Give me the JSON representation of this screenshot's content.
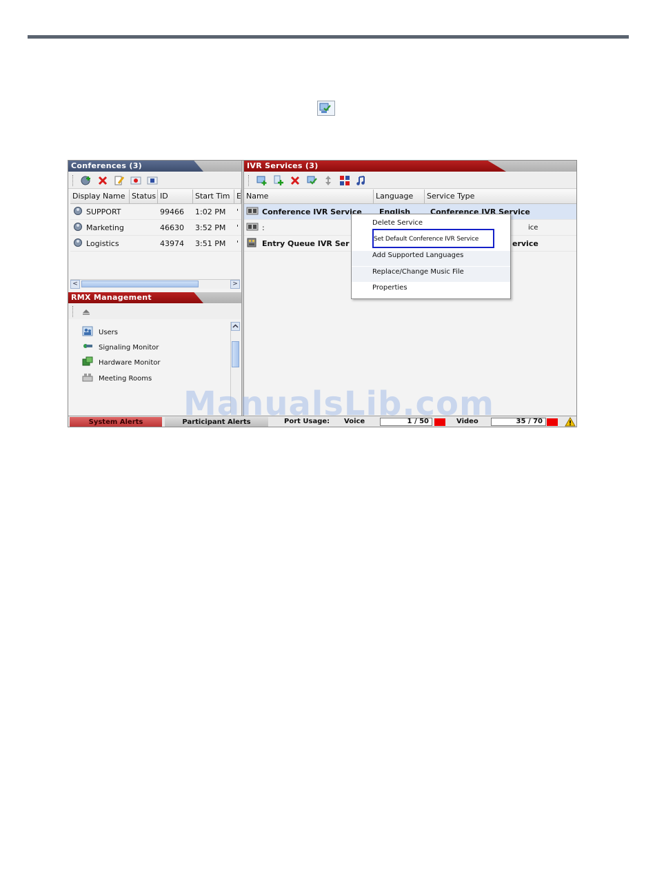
{
  "page": {
    "watermark": "ManualsLib.com",
    "inline_icon": "ivr-set-default-icon"
  },
  "conferences": {
    "title": "Conferences (3)",
    "toolbar_icons": [
      "new-conference-icon",
      "delete-icon",
      "edit-icon",
      "record-icon",
      "stop-icon"
    ],
    "columns": [
      "Display Name",
      "Status",
      "ID",
      "Start Tim",
      "E"
    ],
    "rows": [
      {
        "name": "SUPPORT",
        "status": "",
        "id": "99466",
        "start": "1:02 PM",
        "e": "'"
      },
      {
        "name": "Marketing",
        "status": "",
        "id": "46630",
        "start": "3:52 PM",
        "e": "'"
      },
      {
        "name": "Logistics",
        "status": "",
        "id": "43974",
        "start": "3:51 PM",
        "e": "'"
      }
    ],
    "scroll_left": "<",
    "scroll_right": ">"
  },
  "rmx_management": {
    "title": "RMX Management",
    "items": [
      {
        "label": "Users",
        "icon": "users-icon"
      },
      {
        "label": "Signaling Monitor",
        "icon": "signaling-monitor-icon"
      },
      {
        "label": "Hardware Monitor",
        "icon": "hardware-monitor-icon"
      },
      {
        "label": "Meeting Rooms",
        "icon": "meeting-rooms-icon"
      }
    ]
  },
  "ivr_services": {
    "title": "IVR Services (3)",
    "toolbar_icons": [
      "new-ivr-service-icon",
      "add-icon",
      "delete-icon",
      "set-default-icon",
      "move-icon",
      "language-icon",
      "music-icon"
    ],
    "columns": [
      "Name",
      "Language",
      "Service Type"
    ],
    "rows": [
      {
        "name": "Conference IVR Service",
        "language": "English",
        "type": "Conference IVR Service",
        "selected": true
      },
      {
        "name": ":",
        "language": "",
        "type": "ice",
        "selected": false
      },
      {
        "name": "Entry Queue IVR Ser",
        "language": "",
        "type": "ervice",
        "selected": false
      }
    ]
  },
  "context_menu": {
    "items": [
      "Delete Service",
      "Set Default Conference IVR Service",
      "Add Supported Languages",
      "Replace/Change Music File",
      "Properties"
    ],
    "highlighted_index": 1
  },
  "status_bar": {
    "system_alerts": "System Alerts",
    "participant_alerts": "Participant Alerts",
    "port_usage_label": "Port Usage:",
    "voice_label": "Voice",
    "voice_value": "1 / 50",
    "video_label": "Video",
    "video_value": "35 / 70",
    "colors": {
      "alarm": "#ee0000",
      "warning": "#f2c200"
    }
  }
}
